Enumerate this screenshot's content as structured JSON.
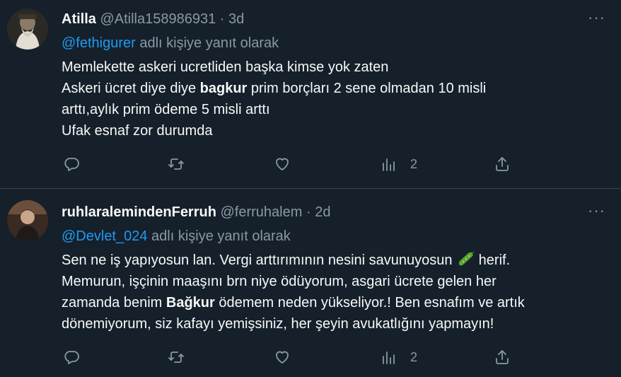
{
  "tweets": [
    {
      "name": "Atilla",
      "handle": "@Atilla158986931",
      "dot": "·",
      "time": "3d",
      "reply_to_mention": "@fethigurer",
      "reply_to_suffix": " adlı kişiye yanıt olarak",
      "lines": [
        [
          "Memlekette askeri ucretliden başka kimse yok zaten"
        ],
        [
          "Askeri ücret diye diye ",
          "bagkur",
          " prim borçları 2 sene olmadan 10 misli"
        ],
        [
          "arttı,aylık prim ödeme 5 misli arttı"
        ],
        [
          "Ufak esnaf zor durumda"
        ]
      ],
      "views": "2",
      "more": "···"
    },
    {
      "name": "ruhlaralemindenFerruh",
      "handle": "@ferruhalem",
      "dot": "·",
      "time": "2d",
      "reply_to_mention": "@Devlet_024",
      "reply_to_suffix": " adlı kişiye yanıt olarak",
      "lines": [
        [
          "Sen ne iş yapıyosun lan. Vergi arttırımının nesini savunuyosun ",
          " herif."
        ],
        [
          "Memurun, işçinin maaşını brn niye ödüyorum, asgari ücrete gelen her"
        ],
        [
          "zamanda benim ",
          "Bağkur",
          " ödemem neden yükseliyor.! Ben esnafım ve artık"
        ],
        [
          "dönemiyorum, siz kafayı yemişsiniz, her şeyin avukatlığını yapmayın!"
        ]
      ],
      "views": "2",
      "more": "···"
    }
  ],
  "icons": {
    "reply": "reply-icon",
    "retweet": "retweet-icon",
    "like": "like-icon",
    "views": "views-icon",
    "share": "share-icon",
    "emoji": "cucumber-emoji"
  },
  "colors": {
    "background": "#15202b",
    "text": "#f7f9f9",
    "secondary": "#8b98a5",
    "link": "#1d9bf0",
    "divider": "#38444d"
  }
}
